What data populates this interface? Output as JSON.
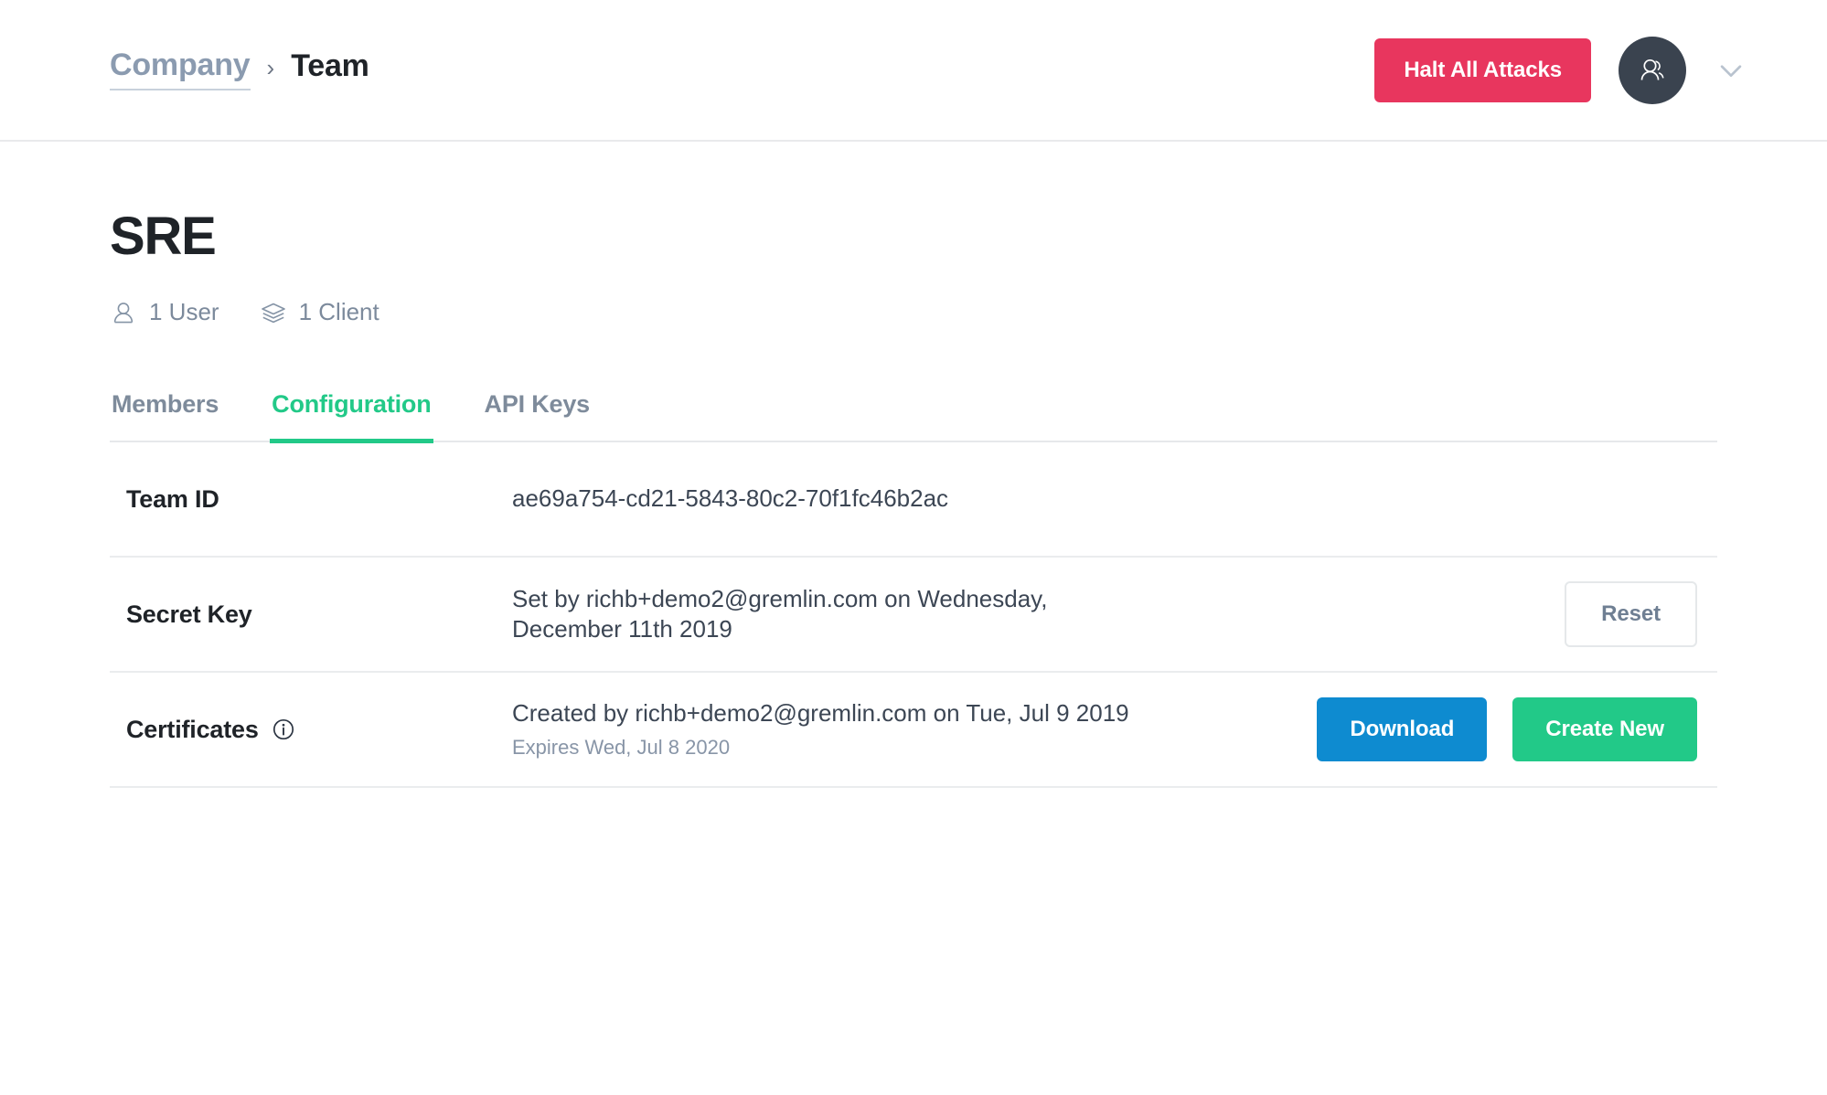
{
  "header": {
    "breadcrumb": {
      "parent": "Company",
      "separator": "›",
      "current": "Team"
    },
    "halt_button_label": "Halt All Attacks",
    "avatar_icon": "users-icon",
    "dropdown_icon": "chevron-down-icon",
    "accent_red": "#e8365e",
    "avatar_bg": "#3a434f"
  },
  "page": {
    "title": "SRE",
    "meta": [
      {
        "icon": "user-icon",
        "label": "1 User"
      },
      {
        "icon": "layers-icon",
        "label": "1 Client"
      }
    ]
  },
  "tabs": [
    {
      "label": "Members",
      "active": false
    },
    {
      "label": "Configuration",
      "active": true
    },
    {
      "label": "API Keys",
      "active": false
    }
  ],
  "accent_green": "#22c988",
  "accent_blue": "#0e8bd0",
  "config": {
    "team_id": {
      "label": "Team ID",
      "value": "ae69a754-cd21-5843-80c2-70f1fc46b2ac"
    },
    "secret_key": {
      "label": "Secret Key",
      "value_line1": "Set by richb+demo2@gremlin.com on",
      "value_line2": "Wednesday, December 11th 2019",
      "reset_label": "Reset"
    },
    "certificates": {
      "label": "Certificates",
      "info_icon": "info-icon",
      "value_line1": "Created by richb+demo2@gremlin.com on",
      "value_line2": "Tue, Jul 9 2019",
      "expires": "Expires Wed, Jul 8 2020",
      "download_label": "Download",
      "create_label": "Create New"
    }
  }
}
